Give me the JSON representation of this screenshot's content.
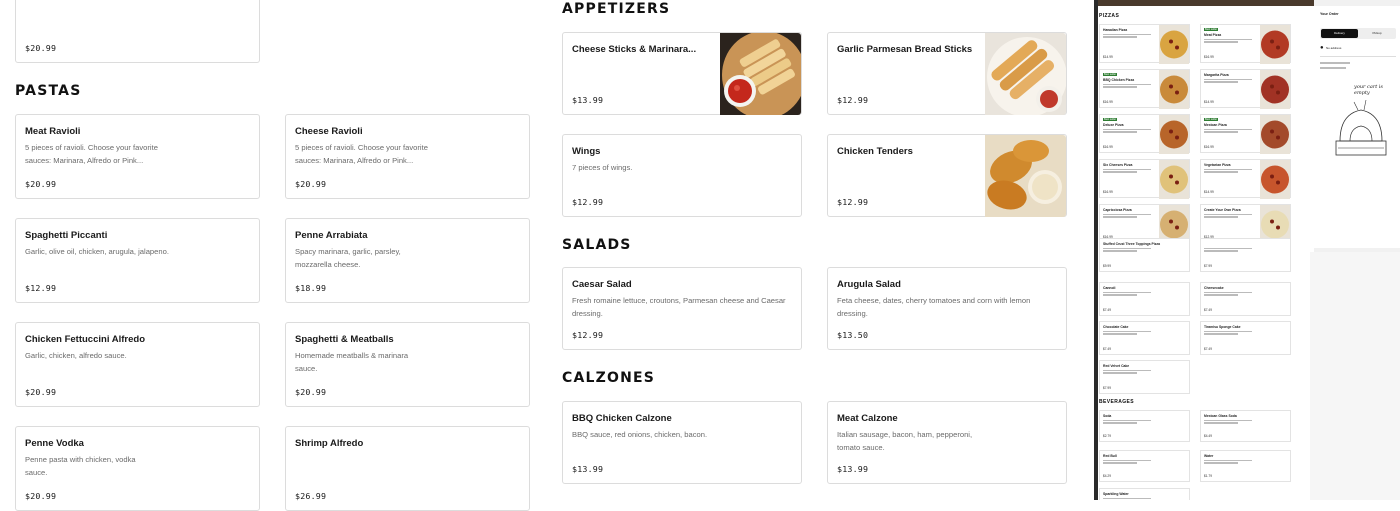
{
  "menu": {
    "top_partial_card": {
      "price": "$20.99"
    },
    "pastas": {
      "title": "PASTAS",
      "items": [
        {
          "name": "Meat Ravioli",
          "desc": "5 pieces of ravioli. Choose your favorite sauces: Marinara, Alfredo or Pink...",
          "price": "$20.99"
        },
        {
          "name": "Cheese Ravioli",
          "desc": "5 pieces of ravioli. Choose your favorite sauces: Marinara, Alfredo or Pink...",
          "price": "$20.99"
        },
        {
          "name": "Spaghetti Piccanti",
          "desc": "Garlic, olive oil, chicken, arugula, jalapeno.",
          "price": "$12.99"
        },
        {
          "name": "Penne Arrabiata",
          "desc": "Spacy marinara, garlic, parsley, mozzarella cheese.",
          "price": "$18.99"
        },
        {
          "name": "Chicken Fettuccini Alfredo",
          "desc": "Garlic, chicken, alfredo sauce.",
          "price": "$20.99"
        },
        {
          "name": "Spaghetti & Meatballs",
          "desc": "Homemade meatballs & marinara sauce.",
          "price": "$20.99"
        },
        {
          "name": "Penne Vodka",
          "desc": "Penne pasta with chicken, vodka sauce.",
          "price": "$20.99"
        },
        {
          "name": "Shrimp Alfredo",
          "desc": "",
          "price": "$26.99"
        }
      ]
    },
    "appetizers": {
      "title": "APPETIZERS",
      "items": [
        {
          "name": "Cheese Sticks & Marinara...",
          "desc": "",
          "price": "$13.99",
          "image": "cheese-sticks-photo"
        },
        {
          "name": "Garlic Parmesan Bread Sticks",
          "desc": "",
          "price": "$12.99",
          "image": "bread-sticks-photo"
        },
        {
          "name": "Wings",
          "desc": "7 pieces of wings.",
          "price": "$12.99"
        },
        {
          "name": "Chicken Tenders",
          "desc": "",
          "price": "$12.99",
          "image": "chicken-tenders-photo"
        }
      ]
    },
    "salads": {
      "title": "SALADS",
      "items": [
        {
          "name": "Caesar Salad",
          "desc": "Fresh romaine lettuce, croutons, Parmesan cheese and Caesar dressing.",
          "price": "$12.99"
        },
        {
          "name": "Arugula Salad",
          "desc": "Feta cheese, dates, cherry tomatoes and corn with lemon dressing.",
          "price": "$13.50"
        }
      ]
    },
    "calzones": {
      "title": "CALZONES",
      "items": [
        {
          "name": "BBQ Chicken Calzone",
          "desc": "BBQ sauce, red onions, chicken, bacon.",
          "price": "$13.99"
        },
        {
          "name": "Meat Calzone",
          "desc": "Italian sausage, bacon, ham, pepperoni, tomato sauce.",
          "price": "$13.99"
        }
      ]
    }
  },
  "preview": {
    "pizzas_title": "PIZZAS",
    "beverages_title": "BEVERAGES",
    "pizzas": [
      {
        "name": "Hawaiian Pizza",
        "price": "$14.99"
      },
      {
        "name": "Meat Pizza",
        "price": "$16.99",
        "badge": "Best seller"
      },
      {
        "name": "BBQ Chicken Pizza",
        "price": "$16.99",
        "badge": "Best seller"
      },
      {
        "name": "Margarita Pizza",
        "price": "$14.99"
      },
      {
        "name": "Deluxe Pizza",
        "price": "$16.99",
        "badge": "Best seller"
      },
      {
        "name": "Mexican Pizza",
        "price": "$16.99",
        "badge": "Best seller"
      },
      {
        "name": "Six Cheeses Pizza",
        "price": "$16.99"
      },
      {
        "name": "Vegetarian Pizza",
        "price": "$14.99"
      },
      {
        "name": "Capricciosa Pizza",
        "price": "$16.99"
      },
      {
        "name": "Create Your Own Pizza",
        "price": "$12.99"
      }
    ],
    "desserts": [
      {
        "name": "Stuffed Crust Three Toppings Pizza",
        "price": "$9.99"
      },
      {
        "name": "",
        "price": "$7.99"
      },
      {
        "name": "Cannoli",
        "price": "$7.49"
      },
      {
        "name": "Cheesecake",
        "price": "$7.49"
      },
      {
        "name": "Chocolate Cake",
        "price": "$7.49"
      },
      {
        "name": "Tiramisu Sponge Cake",
        "price": "$7.49"
      },
      {
        "name": "Red Velvet Cake",
        "price": "$7.99"
      }
    ],
    "beverages": [
      {
        "name": "Soda",
        "price": "$2.79"
      },
      {
        "name": "Mexican Glass Soda",
        "price": "$4.49"
      },
      {
        "name": "Red Bull",
        "price": "$4.29"
      },
      {
        "name": "Water",
        "price": "$1.79"
      },
      {
        "name": "Sparkling Water",
        "price": ""
      }
    ],
    "order": {
      "title": "Your Order",
      "delivery": "Delivery",
      "pickup": "Pickup",
      "address": "No address",
      "empty_text": "your cart is empty"
    }
  },
  "colors": {
    "badge": "#2e7d32",
    "border": "#dcdcdc",
    "muted": "#6b6b6b"
  }
}
